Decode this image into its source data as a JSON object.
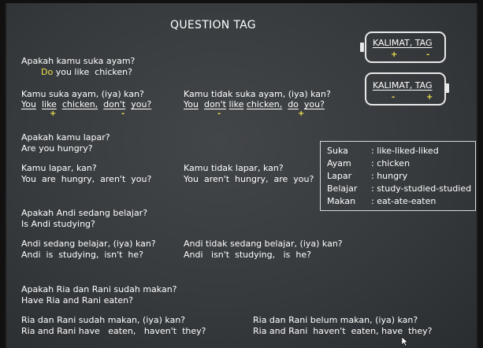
{
  "title": "QUESTION TAG",
  "boxes": [
    {
      "label": "KALIMAT, TAG",
      "signs": [
        "+",
        "-"
      ]
    },
    {
      "label": "KALIMAT, TAG",
      "signs": [
        "-",
        "+"
      ]
    }
  ],
  "ex1": {
    "q_id": "Apakah kamu suka ayam?",
    "q_en": [
      "Do",
      "you like  chicken?"
    ],
    "pos_id": "Kamu suka ayam, (iya) kan?",
    "pos_en": [
      "You",
      "like",
      "chicken,",
      "don't",
      "you?"
    ],
    "neg_id": "Kamu tidak suka ayam, (iya) kan?",
    "neg_en": [
      "You",
      "don't",
      "like",
      "chicken,",
      "do",
      "you?"
    ],
    "signs": [
      "+",
      "-",
      "-",
      "+"
    ]
  },
  "ex2": {
    "q_id": "Apakah kamu lapar?",
    "q_en": "Are you hungry?",
    "pos_id": "Kamu lapar, kan?",
    "pos_en": "You  are  hungry,  aren't  you?",
    "neg_id": "Kamu tidak lapar, kan?",
    "neg_en": "You  aren't  hungry,  are  you?"
  },
  "ex3": {
    "q_id": "Apakah Andi sedang belajar?",
    "q_en": "Is Andi studying?",
    "pos_id": "Andi sedang belajar, (iya) kan?",
    "pos_en": "Andi  is  studying,  isn't  he?",
    "neg_id": "Andi tidak sedang belajar, (iya) kan?",
    "neg_en": "Andi   isn't  studying,   is  he?"
  },
  "ex4": {
    "q_id": "Apakah Ria dan Rani sudah makan?",
    "q_en": "Have Ria and Rani eaten?",
    "pos_id": "Ria dan Rani sudah makan, (iya) kan?",
    "pos_en": "Ria and Rani have   eaten,   haven't  they?",
    "neg_id": "Ria dan Rani belum makan, (iya) kan?",
    "neg_en": "Ria and Rani  haven't  eaten, have  they?"
  },
  "vocab": [
    {
      "word": "Suka",
      "forms": ": like-liked-liked"
    },
    {
      "word": "Ayam",
      "forms": ": chicken"
    },
    {
      "word": "Lapar",
      "forms": ": hungry"
    },
    {
      "word": "Belajar",
      "forms": ": study-studied-studied"
    },
    {
      "word": "Makan",
      "forms": ": eat-ate-eaten"
    }
  ],
  "colors": {
    "board": "#393c3f",
    "highlight": "#f2e14a",
    "text": "#ffffff"
  }
}
